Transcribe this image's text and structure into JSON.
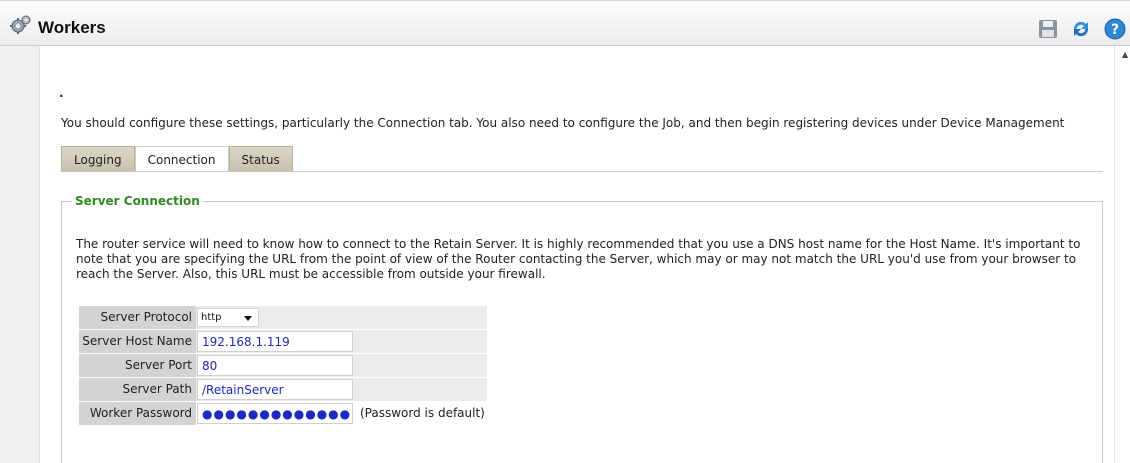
{
  "window": {
    "title": "Workers"
  },
  "toolbar": {
    "icons": [
      "gear-icon",
      "save-icon",
      "refresh-icon",
      "help-icon"
    ],
    "accent": "#1e7fd6"
  },
  "intro": {
    "dot": ".",
    "text": "You should configure these settings, particularly the Connection tab. You also need to configure the Job, and then begin registering devices under Device Management"
  },
  "tabs": [
    {
      "label": "Logging",
      "active": false
    },
    {
      "label": "Connection",
      "active": true
    },
    {
      "label": "Status",
      "active": false
    }
  ],
  "section": {
    "legend": "Server Connection",
    "legend_color": "#2e8b1e",
    "description": "The router service will need to know how to connect to the Retain Server. It is highly recommended that you use a DNS host name for the Host Name. It's important to note that you are specifying the URL from the point of view of the Router contacting the Server, which may or may not match the URL you'd use from your browser to reach the Server. Also, this URL must be accessible from outside your firewall."
  },
  "form": {
    "protocol": {
      "label": "Server Protocol",
      "value": "http"
    },
    "host": {
      "label": "Server Host Name",
      "value": "192.168.1.119"
    },
    "port": {
      "label": "Server Port",
      "value": "80"
    },
    "path": {
      "label": "Server Path",
      "value": "/RetainServer"
    },
    "password": {
      "label": "Worker Password",
      "value": "●●●●●●●●●●●●●",
      "note": "(Password is default)"
    }
  }
}
